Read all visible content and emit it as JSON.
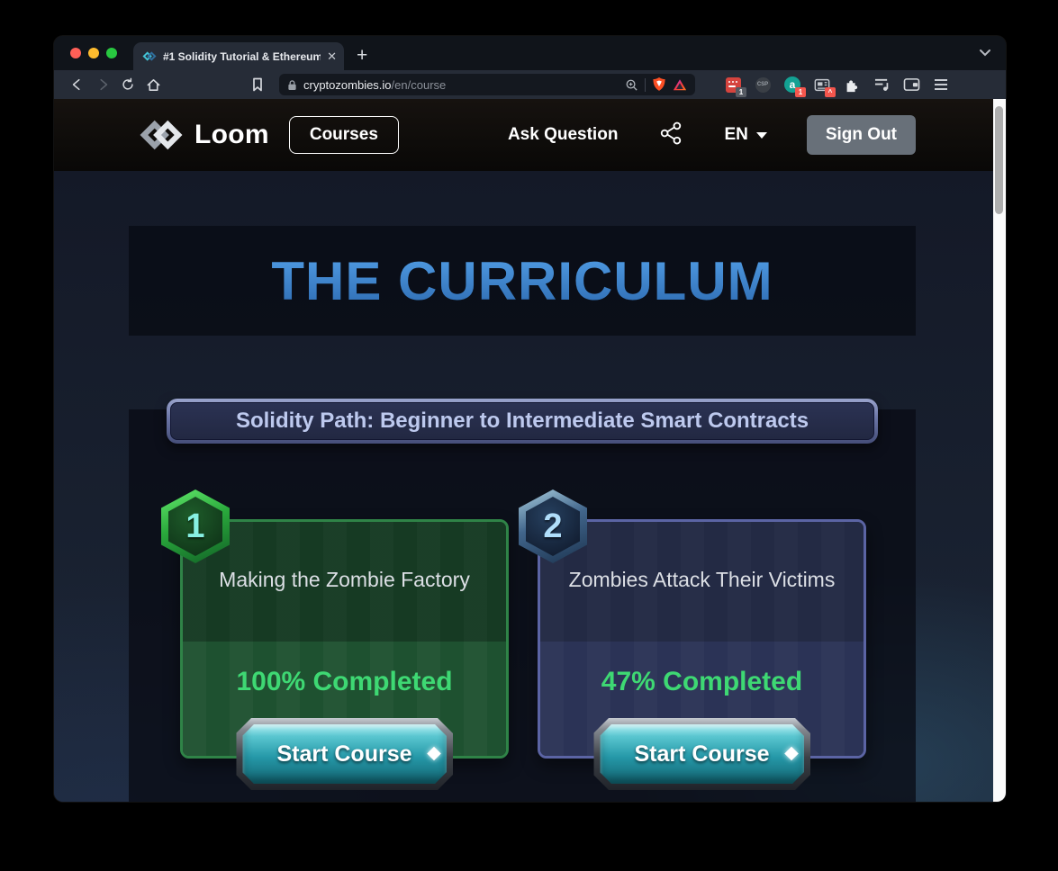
{
  "browser": {
    "tab": {
      "title": "#1 Solidity Tutorial & Ethereum",
      "close_glyph": "✕",
      "new_tab_glyph": "+"
    },
    "url": {
      "domain": "cryptozombies.io",
      "path": "/en/course"
    },
    "extensions": {
      "adblock_badge": "1",
      "csp_label": "CSP",
      "a_extension_label": "a",
      "a_extension_badge": "1",
      "reader_badge": "^"
    }
  },
  "site_header": {
    "brand": "Loom",
    "courses_label": "Courses",
    "ask_question_label": "Ask Question",
    "language": "EN",
    "sign_out_label": "Sign Out"
  },
  "main": {
    "title": "THE CURRICULUM",
    "path_banner": "Solidity Path: Beginner to Intermediate Smart Contracts",
    "courses": [
      {
        "number": "1",
        "title": "Making the Zombie Factory",
        "completed": "100% Completed",
        "cta": "Start Course"
      },
      {
        "number": "2",
        "title": "Zombies Attack Their Victims",
        "completed": "47% Completed",
        "cta": "Start Course"
      }
    ]
  },
  "colors": {
    "curriculum_blue": "#3d87d3",
    "completed_green": "#3ed873",
    "card1_border": "#2f8347",
    "card2_border": "#5b64a4",
    "button_teal": "#2598a8",
    "brave_shield_orange": "#fb4f24"
  }
}
